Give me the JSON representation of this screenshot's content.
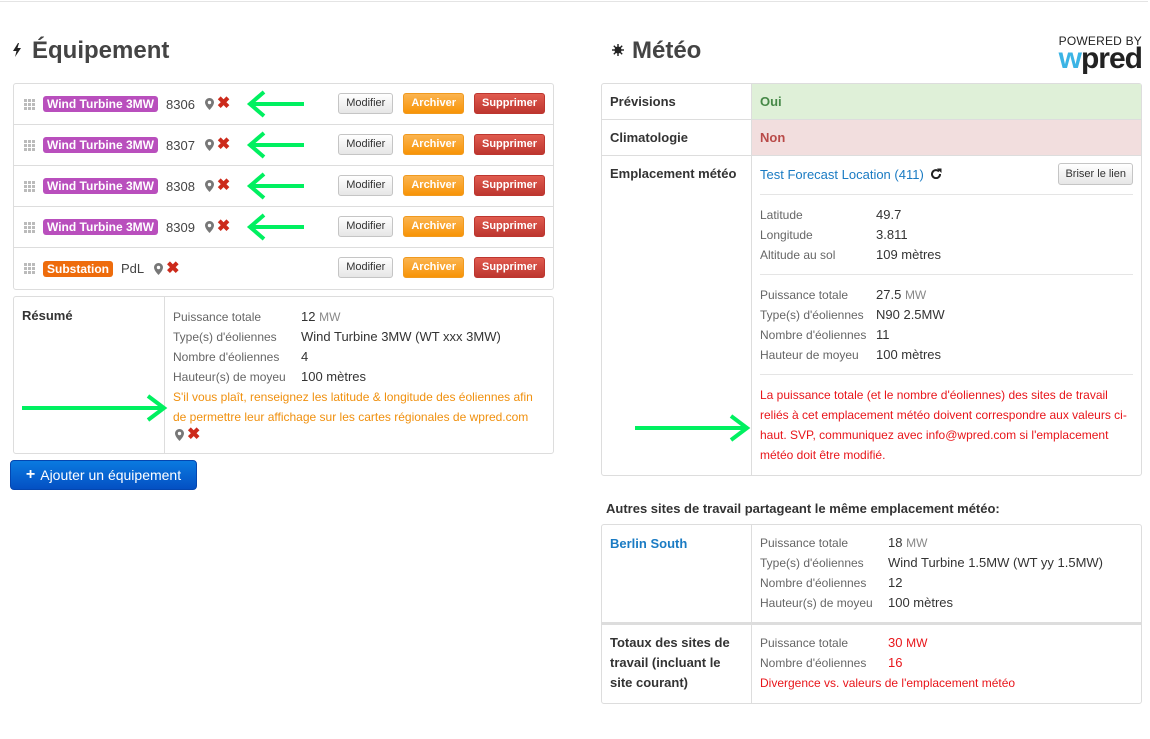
{
  "equipment": {
    "title": "Équipement",
    "icon": "bolt-icon",
    "items": [
      {
        "type": "Wind Turbine 3MW",
        "badge_color": "#b94fbd",
        "id": "8306",
        "has_arrow": true
      },
      {
        "type": "Wind Turbine 3MW",
        "badge_color": "#b94fbd",
        "id": "8307",
        "has_arrow": true
      },
      {
        "type": "Wind Turbine 3MW",
        "badge_color": "#b94fbd",
        "id": "8308",
        "has_arrow": true
      },
      {
        "type": "Wind Turbine 3MW",
        "badge_color": "#b94fbd",
        "id": "8309",
        "has_arrow": true
      },
      {
        "type": "Substation",
        "badge_color": "#ee6c0c",
        "id": "PdL",
        "has_arrow": false
      }
    ],
    "buttons": {
      "edit": "Modifier",
      "archive": "Archiver",
      "delete": "Supprimer"
    },
    "summary": {
      "label": "Résumé",
      "rows": [
        {
          "key": "Puissance totale",
          "value": "12",
          "unit": "MW"
        },
        {
          "key": "Type(s) d'éoliennes",
          "value": "Wind Turbine 3MW (WT xxx 3MW)",
          "unit": ""
        },
        {
          "key": "Nombre d'éoliennes",
          "value": "4",
          "unit": ""
        },
        {
          "key": "Hauteur(s) de moyeu",
          "value": "100 mètres",
          "unit": ""
        }
      ],
      "warning": "S'il vous plaît, renseignez les latitude & longitude des éoliennes afin de permettre leur affichage sur les cartes régionales de wpred.com"
    },
    "add_button": "Ajouter un équipement"
  },
  "meteo": {
    "title": "Météo",
    "icon": "sun-icon",
    "logo": {
      "powered": "POWERED BY",
      "brand_w": "w",
      "brand_rest": "pred"
    },
    "forecast": {
      "label": "Prévisions",
      "value": "Oui"
    },
    "climatology": {
      "label": "Climatologie",
      "value": "Non"
    },
    "location": {
      "label": "Emplacement météo",
      "link": "Test Forecast Location (411)",
      "break_button": "Briser le lien",
      "coords": [
        {
          "key": "Latitude",
          "value": "49.7"
        },
        {
          "key": "Longitude",
          "value": "3.811"
        },
        {
          "key": "Altitude au sol",
          "value": "109 mètres"
        }
      ],
      "stats": [
        {
          "key": "Puissance totale",
          "value": "27.5",
          "unit": "MW"
        },
        {
          "key": "Type(s) d'éoliennes",
          "value": "N90 2.5MW",
          "unit": ""
        },
        {
          "key": "Nombre d'éoliennes",
          "value": "11",
          "unit": ""
        },
        {
          "key": "Hauteur de moyeu",
          "value": "100 mètres",
          "unit": ""
        }
      ],
      "warning": "La puissance totale (et le nombre d'éoliennes) des sites de travail reliés à cet emplacement météo doivent correspondre aux valeurs ci-haut. SVP, communiquez avec info@wpred.com si l'emplacement météo doit être modifié."
    },
    "others_title": "Autres sites de travail partageant le même emplacement météo:",
    "others": [
      {
        "site": "Berlin South",
        "rows": [
          {
            "key": "Puissance totale",
            "value": "18",
            "unit": "MW"
          },
          {
            "key": "Type(s) d'éoliennes",
            "value": "Wind Turbine 1.5MW (WT yy 1.5MW)",
            "unit": ""
          },
          {
            "key": "Nombre d'éoliennes",
            "value": "12",
            "unit": ""
          },
          {
            "key": "Hauteur(s) de moyeu",
            "value": "100 mètres",
            "unit": ""
          }
        ]
      }
    ],
    "totals": {
      "label": "Totaux des sites de travail (incluant le site courant)",
      "rows": [
        {
          "key": "Puissance totale",
          "value": "30",
          "unit": "MW"
        },
        {
          "key": "Nombre d'éoliennes",
          "value": "16",
          "unit": ""
        }
      ],
      "divergence": "Divergence vs. valeurs de l'emplacement météo"
    }
  },
  "colors": {
    "annotation_arrow": "#00f060",
    "success_bg": "#dff0d8",
    "danger_bg": "#f2dede",
    "link": "#1a7bc3",
    "error_text": "#e8151a",
    "warning_text": "#f0900e"
  }
}
